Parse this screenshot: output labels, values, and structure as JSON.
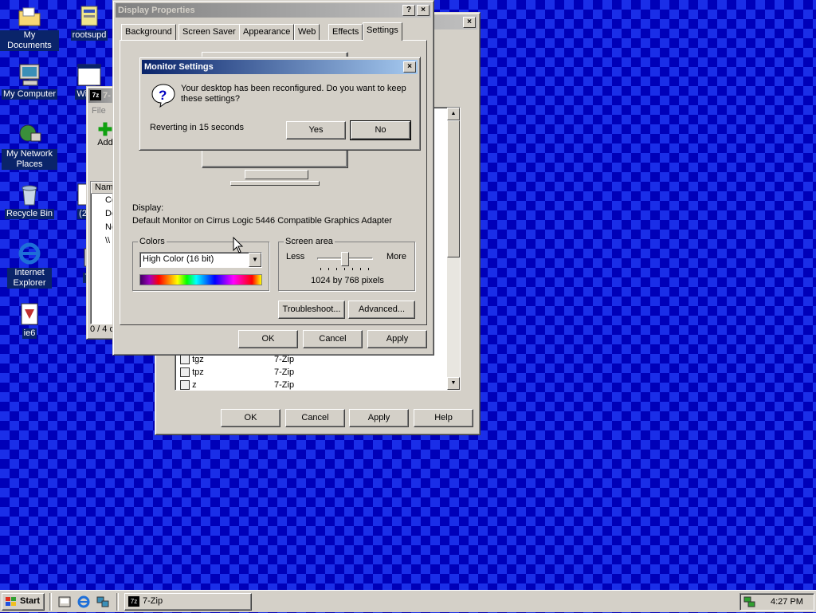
{
  "desktop": {
    "icons": [
      {
        "label": "My Documents"
      },
      {
        "label": "rootsupd"
      },
      {
        "label": "My Computer"
      },
      {
        "label": "Windo"
      },
      {
        "label": "My Network Places"
      },
      {
        "label": "Recycle Bin"
      },
      {
        "label": "(2nd)"
      },
      {
        "label": "Internet Explorer"
      },
      {
        "label": "7z"
      },
      {
        "label": "ie6"
      }
    ]
  },
  "sevenzip_window": {
    "title": "7-",
    "menu_file": "File",
    "toolbar_add": "Add",
    "col_name": "Name",
    "rows": [
      "Co",
      "Do",
      "Ne",
      "\\\\"
    ],
    "status": "0 / 4 c"
  },
  "folder_options": {
    "list_rows": [
      {
        "ext": "tgz",
        "type": "7-Zip"
      },
      {
        "ext": "tpz",
        "type": "7-Zip"
      },
      {
        "ext": "z",
        "type": "7-Zip"
      }
    ],
    "buttons": {
      "ok": "OK",
      "cancel": "Cancel",
      "apply": "Apply",
      "help": "Help"
    }
  },
  "display_properties": {
    "title": "Display Properties",
    "help_btn": "?",
    "close_btn": "×",
    "tabs": [
      "Background",
      "Screen Saver",
      "Appearance",
      "Web",
      "Effects",
      "Settings"
    ],
    "display_label": "Display:",
    "display_value": "Default Monitor on Cirrus Logic 5446 Compatible Graphics Adapter",
    "colors_group": "Colors",
    "colors_value": "High Color (16 bit)",
    "screen_area_group": "Screen area",
    "less_label": "Less",
    "more_label": "More",
    "resolution": "1024 by 768 pixels",
    "slider_position": 0.5,
    "troubleshoot_btn": "Troubleshoot...",
    "advanced_btn": "Advanced...",
    "ok_btn": "OK",
    "cancel_btn": "Cancel",
    "apply_btn": "Apply"
  },
  "monitor_settings": {
    "title": "Monitor Settings",
    "close_btn": "×",
    "message": "Your desktop has been reconfigured.  Do you want to keep these settings?",
    "countdown": "Reverting in 15 seconds",
    "yes_btn": "Yes",
    "no_btn": "No"
  },
  "taskbar": {
    "start_label": "Start",
    "task_label": "7-Zip",
    "clock": "4:27 PM"
  },
  "colors": {
    "desktop_bg": "#0000b8",
    "title_active": "#0a246a",
    "title_inactive": "#808080",
    "face": "#d4d0c8"
  }
}
